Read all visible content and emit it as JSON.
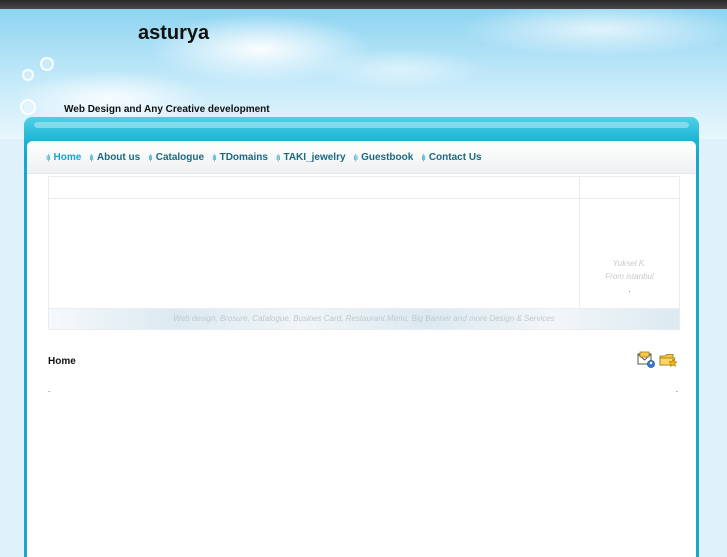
{
  "site": {
    "title": "asturya",
    "slogan": "Web Design and Any Creative development"
  },
  "nav": {
    "items": [
      {
        "label": "Home",
        "active": true
      },
      {
        "label": "About us"
      },
      {
        "label": "Catalogue"
      },
      {
        "label": "TDomains"
      },
      {
        "label": "TAKI_jewelry"
      },
      {
        "label": "Guestbook"
      },
      {
        "label": "Contact Us"
      }
    ],
    "bullet_icon": "sound-wave-icon",
    "bullet_glyph": "ı|ı"
  },
  "sidebar_quote": {
    "author": "Yuksel K.",
    "from": "From istanbul",
    "mark": "."
  },
  "banner_strip": {
    "text": "Web design, Brosure, Catalogue, Busines Card, Restaurant Menu, Big Banner and more Design & Services"
  },
  "content": {
    "heading": "Home",
    "dot_left": ".",
    "dot_right": "."
  },
  "toolbar": {
    "icons": [
      "email-page-icon",
      "bookmark-folder-icon"
    ]
  },
  "colors": {
    "frame": "#1cb4d4",
    "nav_link": "#1c6a80",
    "nav_active": "#19a3d0"
  }
}
